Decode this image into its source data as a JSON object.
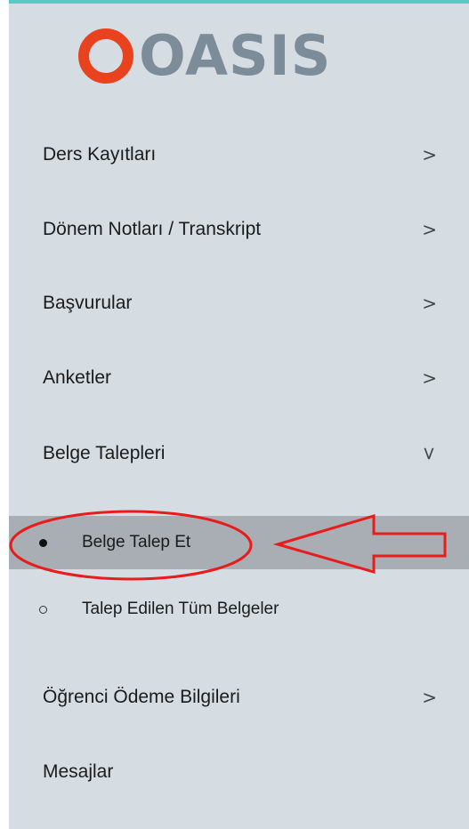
{
  "app": {
    "logo_text": "OASIS",
    "accent_color": "#5ac8c4",
    "logo_mark_color": "#e8421f"
  },
  "menu": [
    {
      "label": "Ders Kayıtları",
      "chevron": ">"
    },
    {
      "label": "Dönem Notları / Transkript",
      "chevron": ">"
    },
    {
      "label": "Başvurular",
      "chevron": ">"
    },
    {
      "label": "Anketler",
      "chevron": ">"
    },
    {
      "label": "Belge Talepleri",
      "chevron": ">"
    }
  ],
  "submenu": [
    {
      "label": "Belge Talep Et",
      "active": true
    },
    {
      "label": "Talep Edilen Tüm Belgeler",
      "active": false
    }
  ],
  "menu_bottom": [
    {
      "label": "Öğrenci Ödeme Bilgileri",
      "chevron": ">"
    },
    {
      "label": "Mesajlar"
    }
  ],
  "annotations": {
    "color": "#e81c1c",
    "icons": [
      "ellipse-highlight",
      "arrow-left-icon"
    ]
  }
}
